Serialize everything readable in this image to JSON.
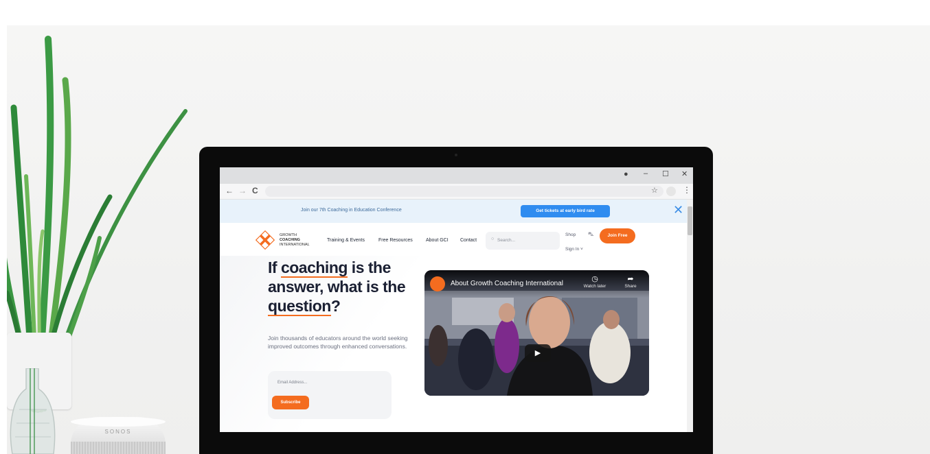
{
  "device": {
    "speaker_brand": "SONOS"
  },
  "browser": {
    "window_controls": [
      "–",
      "☐",
      "✕"
    ],
    "nav": {
      "back": "←",
      "forward": "→",
      "reload": "C"
    },
    "star": "☆",
    "menu": "⋮"
  },
  "announcement": {
    "text": "Join our 7th Coaching in Education Conference",
    "cta": "Get tickets at early bird rate",
    "close": "✕"
  },
  "site": {
    "logo": {
      "line1": "GROWTH",
      "line2": "COACHING",
      "line3": "INTERNATIONAL"
    },
    "nav": [
      {
        "label": "Training & Events"
      },
      {
        "label": "Free Resources"
      },
      {
        "label": "About GCI"
      },
      {
        "label": "Contact"
      }
    ],
    "search_placeholder": "Search...",
    "shop": "Shop",
    "sign_in": "Sign In ˅",
    "join": "Join Free"
  },
  "hero": {
    "title_if": "If ",
    "title_coaching": "coaching",
    "title_rest1": " is the answer, what is the ",
    "title_question": "question",
    "title_end": "?",
    "subtitle": "Join thousands of educators around the world seeking improved outcomes through enhanced conversations.",
    "email_placeholder": "Email Address...",
    "subscribe": "Subscribe"
  },
  "video": {
    "title": "About Growth Coaching International",
    "watch_later": "Watch later",
    "share": "Share",
    "play": "▶"
  },
  "colors": {
    "accent": "#f46c1f",
    "announce_bg": "#e8f2fb",
    "cta_blue": "#2f8cf0",
    "heading": "#1b2033"
  }
}
